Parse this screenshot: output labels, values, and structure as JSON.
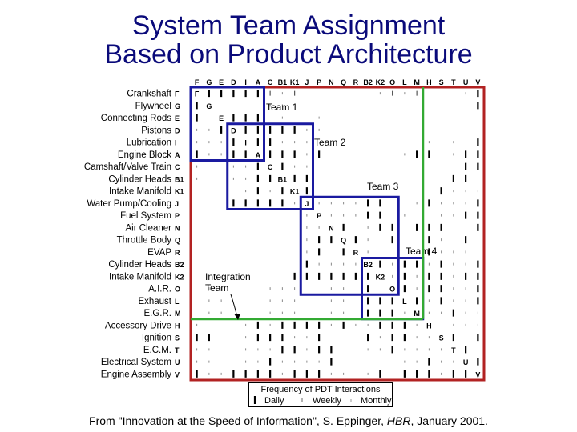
{
  "title": {
    "line1": "System Team Assignment",
    "line2": "Based on Product Architecture"
  },
  "colors": {
    "title": "#0a0a7a",
    "team_box": "#1a1aa0",
    "outer_box": "#b22222",
    "integration_line": "#33aa33"
  },
  "matrix": {
    "columns": [
      "F",
      "G",
      "E",
      "D",
      "I",
      "A",
      "C",
      "B1",
      "K1",
      "J",
      "P",
      "N",
      "Q",
      "R",
      "B2",
      "K2",
      "O",
      "L",
      "M",
      "H",
      "S",
      "T",
      "U",
      "V"
    ],
    "rows": [
      {
        "label": "Crankshaft",
        "code": "F"
      },
      {
        "label": "Flywheel",
        "code": "G"
      },
      {
        "label": "Connecting Rods",
        "code": "E"
      },
      {
        "label": "Pistons",
        "code": "D"
      },
      {
        "label": "Lubrication",
        "code": "I"
      },
      {
        "label": "Engine Block",
        "code": "A"
      },
      {
        "label": "Camshaft/Valve Train",
        "code": "C"
      },
      {
        "label": "Cylinder Heads",
        "code": "B1"
      },
      {
        "label": "Intake Manifold",
        "code": "K1"
      },
      {
        "label": "Water Pump/Cooling",
        "code": "J"
      },
      {
        "label": "Fuel System",
        "code": "P"
      },
      {
        "label": "Air Cleaner",
        "code": "N"
      },
      {
        "label": "Throttle Body",
        "code": "Q"
      },
      {
        "label": "EVAP",
        "code": "R"
      },
      {
        "label": "Cylinder Heads",
        "code": "B2"
      },
      {
        "label": "Intake Manifold",
        "code": "K2"
      },
      {
        "label": "A.I.R.",
        "code": "O"
      },
      {
        "label": "Exhaust",
        "code": "L"
      },
      {
        "label": "E.G.R.",
        "code": "M"
      },
      {
        "label": "Accessory Drive",
        "code": "H"
      },
      {
        "label": "Ignition",
        "code": "S"
      },
      {
        "label": "E.C.M.",
        "code": "T"
      },
      {
        "label": "Electrical System",
        "code": "U"
      },
      {
        "label": "Engine Assembly",
        "code": "V"
      }
    ],
    "interactions_legend": "d = daily, w = weekly, m = monthly; rows are strings of 24 chars aligned with columns, '.' = none, '*' = diagonal",
    "cells": [
      "*dddddwmw......mwmw...md",
      "d*....mm...............dd",
      "d.*ddd.m..m.............d",
      "mmd*dddddmm.............d",
      "mmmd*ddmmm.........m.m.dd",
      "dmmdd*dddmd......mdd.mdd",
      "m..mmd*dmm............ddd",
      "m..mmdd*dd...........dd.d",
      "....mdmd*d..........dmmmd",
      "...dddddm*mmmmdd..mdmmmdd",
      ".........m*mmmdd.m..mmddd",
      ".........mm*d.mdd.ddd..dd",
      ".........mdd*dm.d..dm.d.d",
      ".........md.d*m....dmmm.d",
      ".........dmmmm*dmddmdmmdd",
      "........ddddddd*mdmddmddd",
      ".mm...mmm..mm.d*ddmddmmdd",
      ".mm...mmm..mm.ddd*dmdmmdd",
      ".mm...mmm..mm.dddm*mmdmmd",
      "m...mdmddddmdmmdddmd*mmmd",
      "dd..mdddmmd...dmddmmmd*dd",
      "mm..mmmddmdd..mmdmmmmdd*dd",
      "mm..mmdmmmmd.....mmdmmmdd*d",
      "dmmddddmdddmm.md.dddmddddd*"
    ]
  },
  "teams": [
    {
      "label": "Team 1",
      "from": "F",
      "to": "A"
    },
    {
      "label": "Team 2",
      "from": "D",
      "to": "J"
    },
    {
      "label": "Team 3",
      "from": "J",
      "to": "O"
    },
    {
      "label": "Team 4",
      "from": "B2",
      "to": "M"
    }
  ],
  "integration_team": {
    "label_line1": "Integration",
    "label_line2": "Team"
  },
  "legend": {
    "title": "Frequency of PDT Interactions",
    "items": [
      {
        "key": "d",
        "label": "Daily"
      },
      {
        "key": "w",
        "label": "Weekly"
      },
      {
        "key": "m",
        "label": "Monthly"
      }
    ]
  },
  "caption": {
    "prefix": "From \"Innovation at the Speed of Information\", S. Eppinger, ",
    "journal": "HBR",
    "suffix": ", January 2001."
  }
}
